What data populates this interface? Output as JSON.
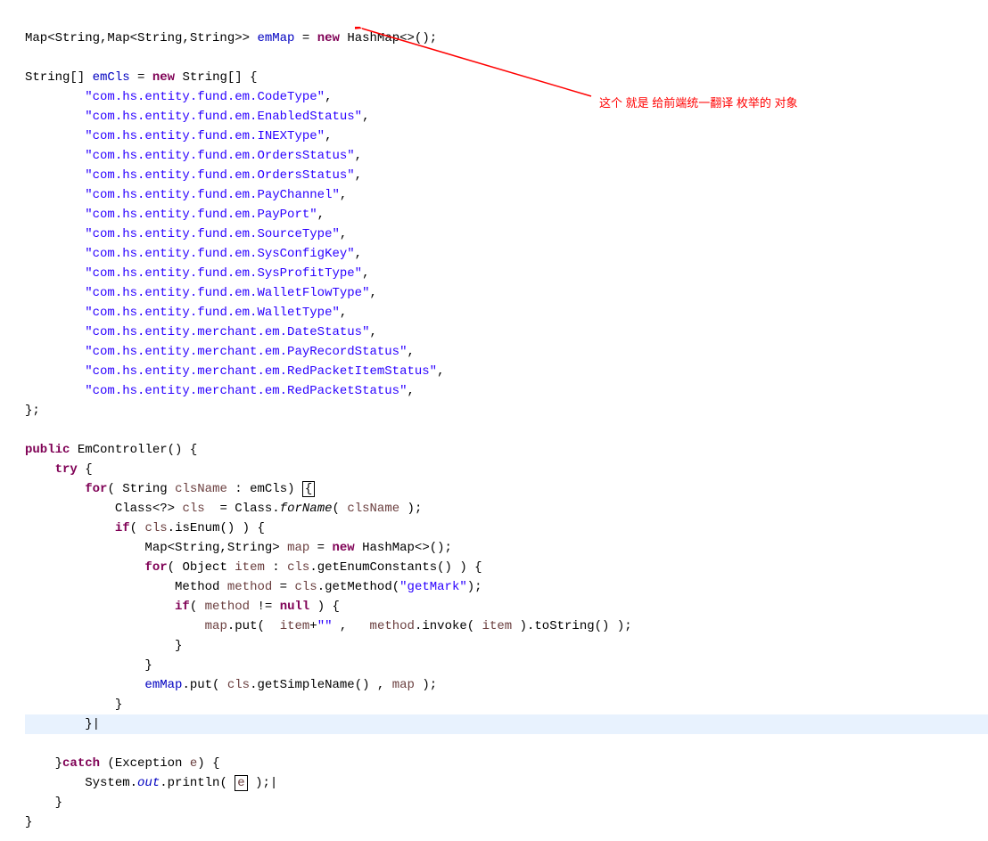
{
  "annotation": "这个 就是   给前端统一翻译 枚举的 对象",
  "code": {
    "line1_type": "Map<String,Map<String,String>>",
    "line1_var": "emMap",
    "line1_new": "new",
    "line1_hashmap": "HashMap<>();",
    "emcls_decl_type": "String[]",
    "emcls_decl_var": "emCls",
    "emcls_decl_new": "new",
    "emcls_decl_rest": "String[] {",
    "strings": [
      "\"com.hs.entity.fund.em.CodeType\"",
      "\"com.hs.entity.fund.em.EnabledStatus\"",
      "\"com.hs.entity.fund.em.INEXType\"",
      "\"com.hs.entity.fund.em.OrdersStatus\"",
      "\"com.hs.entity.fund.em.OrdersStatus\"",
      "\"com.hs.entity.fund.em.PayChannel\"",
      "\"com.hs.entity.fund.em.PayPort\"",
      "\"com.hs.entity.fund.em.SourceType\"",
      "\"com.hs.entity.fund.em.SysConfigKey\"",
      "\"com.hs.entity.fund.em.SysProfitType\"",
      "\"com.hs.entity.fund.em.WalletFlowType\"",
      "\"com.hs.entity.fund.em.WalletType\"",
      "\"com.hs.entity.merchant.em.DateStatus\"",
      "\"com.hs.entity.merchant.em.PayRecordStatus\"",
      "\"com.hs.entity.merchant.em.RedPacketItemStatus\"",
      "\"com.hs.entity.merchant.em.RedPacketStatus\""
    ],
    "close_brace": "};",
    "public": "public",
    "ctor_name": "EmController() {",
    "try": "try",
    "for": "for",
    "clsname_decl": "( String",
    "clsname_var": "clsName",
    "clsname_rest": ": emCls)",
    "cls_decl": "Class<?>",
    "cls_var": "cls",
    "cls_eq": " = Class.",
    "forName": "forName",
    "forName_arg": "(",
    "clsName_ref": "clsName",
    "forName_close": " );",
    "if": "if",
    "if_cond": "(",
    "cls_ref": "cls",
    "isEnum": ".isEnum() ) {",
    "map_decl": "Map<String,String>",
    "map_var": "map",
    "map_new": "new",
    "map_hashmap": "HashMap<>();",
    "for2": "for",
    "for2_obj": "( Object",
    "item_var": "item",
    "for2_rest": ":",
    "cls_ref2": "cls",
    "getEnum": ".getEnumConstants() ) {",
    "method_decl": "Method",
    "method_var": "method",
    "method_eq": " =",
    "cls_ref3": "cls",
    "getMethod": ".getMethod(",
    "getmark": "\"getMark\"",
    "getMethod_close": ");",
    "if2": "if",
    "if2_open": "(",
    "method_ref": "method",
    "if2_ne": " !=",
    "null": "null",
    "if2_close": " ) {",
    "map_ref": "map",
    "put": ".put( ",
    "item_ref": "item",
    "plus": "+",
    "emptystr": "\"\"",
    "put_mid": " , ",
    "method_ref2": "method",
    "invoke": ".invoke(",
    "item_ref2": "item",
    "invoke_close": " ).toString() );",
    "close1": "}",
    "close2": "}",
    "emMap_ref": "emMap",
    "emmap_put": ".put(",
    "cls_ref4": "cls",
    "getSimple": ".getSimpleName() ,",
    "map_ref2": "map",
    "emmap_close": " );",
    "close3": "}",
    "close4": "}",
    "catch": "catch",
    "catch_rest": " (Exception",
    "e_var": "e",
    "catch_close": ") {",
    "system": "System.",
    "out": "out",
    "println": ".println(",
    "e_ref": "e",
    "println_close": ");",
    "close5": "}",
    "close6": "}"
  }
}
